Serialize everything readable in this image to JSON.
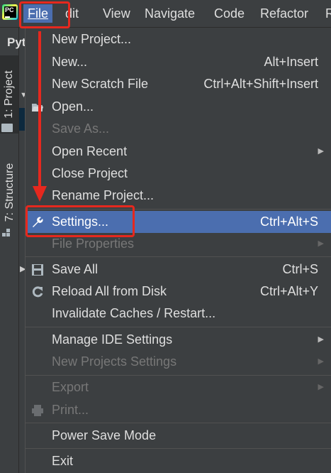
{
  "menubar": {
    "logo": "PC",
    "items": [
      {
        "label": "File",
        "active": true
      },
      {
        "label": "Edit",
        "visible_text": "dit"
      },
      {
        "label": "View"
      },
      {
        "label": "Navigate"
      },
      {
        "label": "Code"
      },
      {
        "label": "Refactor"
      },
      {
        "label": "R"
      }
    ]
  },
  "background": {
    "project_title_partial": "Pyt",
    "tool_windows": [
      "1: Project",
      "7: Structure"
    ]
  },
  "file_menu": {
    "items": [
      {
        "label": "New Project...",
        "shortcut": "",
        "enabled": true
      },
      {
        "label": "New...",
        "shortcut": "Alt+Insert",
        "enabled": true
      },
      {
        "label": "New Scratch File",
        "shortcut": "Ctrl+Alt+Shift+Insert",
        "enabled": true
      },
      {
        "label": "Open...",
        "shortcut": "",
        "enabled": true,
        "icon": "folder-open-icon"
      },
      {
        "label": "Save As...",
        "shortcut": "",
        "enabled": false
      },
      {
        "label": "Open Recent",
        "shortcut": "",
        "enabled": true,
        "submenu": true
      },
      {
        "label": "Close Project",
        "shortcut": "",
        "enabled": true
      },
      {
        "label": "Rename Project...",
        "shortcut": "",
        "enabled": true
      },
      {
        "label": "Settings...",
        "shortcut": "Ctrl+Alt+S",
        "enabled": true,
        "selected": true,
        "icon": "wrench-icon"
      },
      {
        "label": "File Properties",
        "shortcut": "",
        "enabled": false,
        "submenu": true
      },
      {
        "label": "Save All",
        "shortcut": "Ctrl+S",
        "enabled": true,
        "icon": "floppy-disk-icon"
      },
      {
        "label": "Reload All from Disk",
        "shortcut": "Ctrl+Alt+Y",
        "enabled": true,
        "icon": "reload-icon"
      },
      {
        "label": "Invalidate Caches / Restart...",
        "shortcut": "",
        "enabled": true
      },
      {
        "label": "Manage IDE Settings",
        "shortcut": "",
        "enabled": true,
        "submenu": true
      },
      {
        "label": "New Projects Settings",
        "shortcut": "",
        "enabled": false,
        "submenu": true
      },
      {
        "label": "Export",
        "shortcut": "",
        "enabled": false,
        "submenu": true
      },
      {
        "label": "Print...",
        "shortcut": "",
        "enabled": false,
        "icon": "printer-icon"
      },
      {
        "label": "Power Save Mode",
        "shortcut": "",
        "enabled": true
      },
      {
        "label": "Exit",
        "shortcut": "",
        "enabled": true
      }
    ]
  },
  "colors": {
    "menu_bg": "#3c3f41",
    "selection": "#4b6eaf",
    "annotation": "#e6281e",
    "text": "#dfdfdf",
    "disabled_text": "#777777"
  }
}
